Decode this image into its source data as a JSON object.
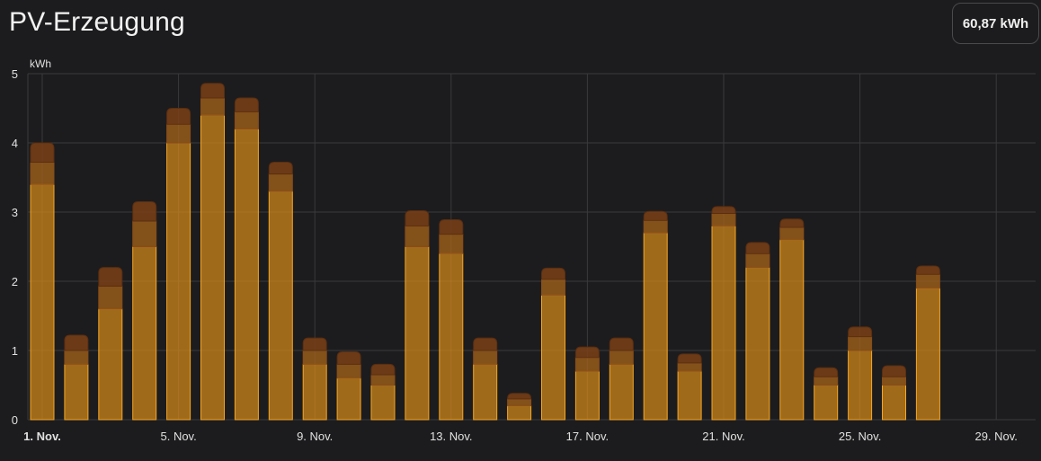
{
  "header": {
    "title": "PV-Erzeugung",
    "total": "60,87 kWh"
  },
  "colors": {
    "background": "#1c1c1e",
    "grid": "#3a3a3c",
    "bar_main": "#d4891a",
    "bar_border": "#f5a623",
    "bar_mid": "#a5631a",
    "bar_top": "#7a3f16"
  },
  "chart_data": {
    "type": "bar",
    "stacked": true,
    "ylabel": "kWh",
    "ylim": [
      0,
      5
    ],
    "yticks": [
      0,
      1,
      2,
      3,
      4,
      5
    ],
    "xticks": [
      "1. Nov.",
      "5. Nov.",
      "9. Nov.",
      "13. Nov.",
      "17. Nov.",
      "21. Nov.",
      "25. Nov.",
      "29. Nov."
    ],
    "x_range_days": [
      1,
      30
    ],
    "grid": true,
    "days": [
      1,
      2,
      3,
      4,
      5,
      6,
      7,
      8,
      9,
      10,
      11,
      12,
      13,
      14,
      15,
      16,
      17,
      18,
      19,
      20,
      21,
      22,
      23,
      24,
      25,
      26,
      27,
      28
    ],
    "series": [
      {
        "values": [
          3.4,
          0.8,
          1.6,
          2.5,
          4.0,
          4.4,
          4.2,
          3.3,
          0.8,
          0.6,
          0.5,
          2.5,
          2.4,
          0.8,
          0.2,
          1.8,
          0.7,
          0.8,
          2.7,
          0.7,
          2.8,
          2.2,
          2.6,
          0.5,
          1.0,
          0.5,
          1.9,
          0
        ]
      },
      {
        "values": [
          0.32,
          0.2,
          0.33,
          0.37,
          0.27,
          0.25,
          0.25,
          0.25,
          0.2,
          0.2,
          0.15,
          0.3,
          0.28,
          0.2,
          0.1,
          0.23,
          0.2,
          0.2,
          0.18,
          0.12,
          0.18,
          0.2,
          0.18,
          0.12,
          0.2,
          0.12,
          0.2,
          0
        ]
      },
      {
        "values": [
          0.28,
          0.22,
          0.27,
          0.28,
          0.23,
          0.21,
          0.2,
          0.17,
          0.18,
          0.18,
          0.15,
          0.22,
          0.21,
          0.18,
          0.08,
          0.16,
          0.15,
          0.18,
          0.13,
          0.13,
          0.1,
          0.16,
          0.12,
          0.13,
          0.14,
          0.16,
          0.12,
          0
        ]
      }
    ]
  }
}
